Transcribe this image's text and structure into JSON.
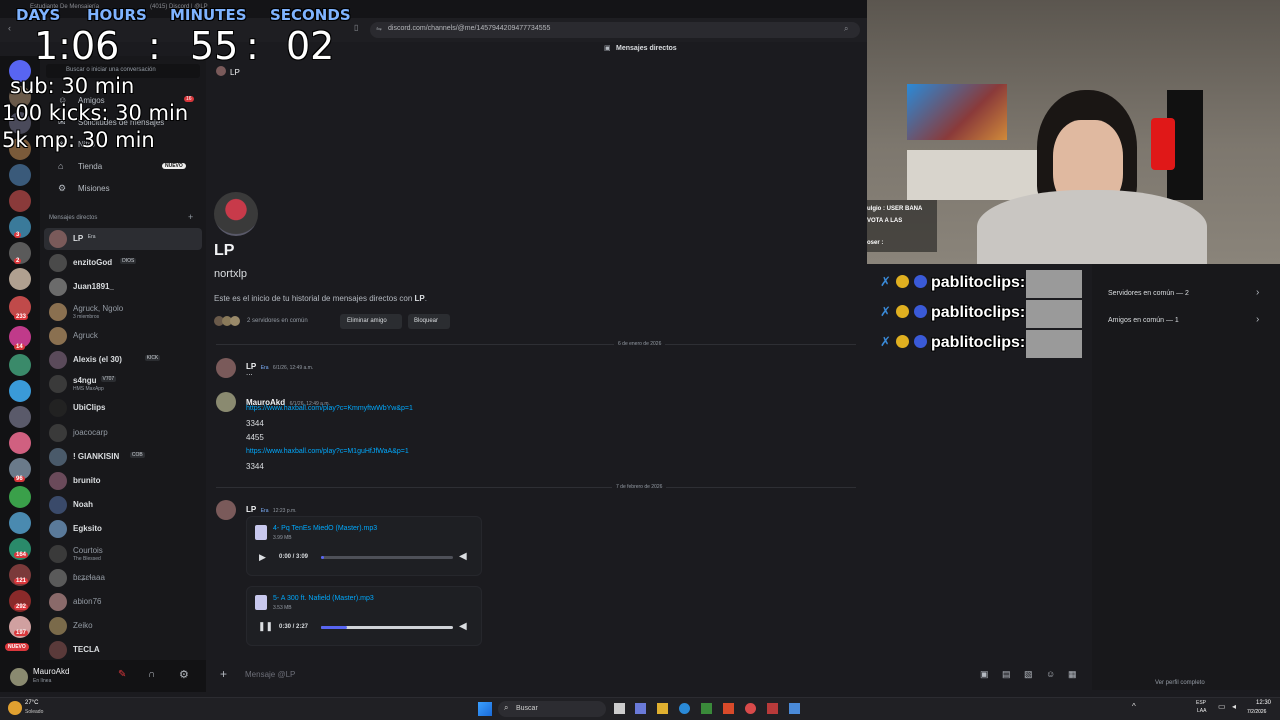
{
  "overlay": {
    "labels": {
      "days": "DAYS",
      "hours": "HOURS",
      "minutes": "MINUTES",
      "seconds": "SECONDS"
    },
    "time": {
      "hours": "1:06",
      "minutes": "55",
      "seconds": "02"
    },
    "rules": [
      "sub: 30 min",
      "100 kicks: 30 min",
      "5k mp: 30 min"
    ]
  },
  "browser": {
    "tabs": [
      "Estudiante De Mensajería",
      "(4015) Discord | @LP"
    ],
    "url": "discord.com/channels/@me/1457944209477734555"
  },
  "discord": {
    "top_title": "Mensajes directos",
    "search_placeholder": "Buscar o iniciar una conversación",
    "header_name": "LP",
    "nav": [
      {
        "label": "Amigos",
        "badge": "16"
      },
      {
        "label": "Solicitudes de mensajes",
        "badge": ""
      },
      {
        "label": "Nitro",
        "badge": ""
      },
      {
        "label": "Tienda",
        "badge": "NUEVO"
      },
      {
        "label": "Misiones",
        "badge": ""
      }
    ],
    "dm_section": "Mensajes directos",
    "dms": [
      {
        "name": "LP",
        "tag": "Era",
        "sub": "",
        "color": "#7a5a5a",
        "dim": false
      },
      {
        "name": "enzitoGod",
        "tag": "DIOS",
        "sub": "",
        "color": "#4a4a4a",
        "dim": false
      },
      {
        "name": "Juan1891_",
        "tag": "",
        "sub": "",
        "color": "#6b6b6b",
        "dim": false
      },
      {
        "name": "Agruck, Ngolo",
        "tag": "",
        "sub": "3 miembros",
        "color": "#8a7050",
        "dim": true
      },
      {
        "name": "Agruck",
        "tag": "",
        "sub": "",
        "color": "#8a7050",
        "dim": true
      },
      {
        "name": "Alexis (el 30)",
        "tag": "KICK",
        "sub": "",
        "color": "#5a4a5a",
        "dim": false
      },
      {
        "name": "s4ngu",
        "tag": "V707",
        "sub": "HMS MaxApp",
        "color": "#3a3a3a",
        "dim": false
      },
      {
        "name": "UbiClips",
        "tag": "",
        "sub": "",
        "color": "#222",
        "dim": false
      },
      {
        "name": "joacocarp",
        "tag": "",
        "sub": "",
        "color": "#3a3a3a",
        "dim": true
      },
      {
        "name": "! GIANKISIN",
        "tag": "COB",
        "sub": "",
        "color": "#4a5a6a",
        "dim": false
      },
      {
        "name": "brunito",
        "tag": "",
        "sub": "",
        "color": "#6a4a5a",
        "dim": false
      },
      {
        "name": "Noah",
        "tag": "",
        "sub": "",
        "color": "#3a4a6a",
        "dim": false
      },
      {
        "name": "Egksito",
        "tag": "",
        "sub": "",
        "color": "#5a7a9a",
        "dim": false
      },
      {
        "name": "Courtois",
        "tag": "",
        "sub": "The Blessed",
        "color": "#3a3a3a",
        "dim": true
      },
      {
        "name": "ɓɛʑɛɬaaa",
        "tag": "",
        "sub": "",
        "color": "#5a5a5a",
        "dim": true
      },
      {
        "name": "abion76",
        "tag": "",
        "sub": "",
        "color": "#8a6a6a",
        "dim": true
      },
      {
        "name": "Zeiko",
        "tag": "",
        "sub": "",
        "color": "#7a6a4a",
        "dim": true
      },
      {
        "name": "TECLA",
        "tag": "",
        "sub": "",
        "color": "#5a3a3a",
        "dim": false
      }
    ],
    "user": {
      "name": "MauroAkd",
      "status": "En línea"
    },
    "profile": {
      "display": "LP",
      "username": "nortxlp",
      "intro_prefix": "Este es el inicio de tu historial de mensajes directos con ",
      "intro_name": "LP",
      "intro_suffix": ".",
      "mutual": "2 servidores en común",
      "remove": "Eliminar amigo",
      "block": "Bloquear"
    },
    "dividers": [
      "6 de enero de 2026",
      "7 de febrero de 2026"
    ],
    "messages": [
      {
        "author": "LP",
        "tag": "Era",
        "time": "6/1/26, 12:49 a.m.",
        "lines": [
          "..."
        ]
      },
      {
        "author": "MauroAkd",
        "tag": "",
        "time": "6/1/26, 12:49 a.m.",
        "link1": "https://www.haxball.com/play?c=KmmyftwWbYw&p=1",
        "lines": [
          "3344",
          "4455"
        ],
        "link2": "https://www.haxball.com/play?c=M1guHfJfWaA&p=1",
        "tail": "3344"
      },
      {
        "author": "LP",
        "tag": "Era",
        "time": "12:23 p.m."
      }
    ],
    "attachments": [
      {
        "title": "4- Pq TenEs MiedO (Master).mp3",
        "size": "3.99 MB",
        "time": "0:00 / 3:09",
        "progress": 0.02,
        "playing": false
      },
      {
        "title": "5- A 300 ft. Nafield (Master).mp3",
        "size": "3.53 MB",
        "time": "0:30 / 2:27",
        "progress": 0.2,
        "playing": true
      }
    ],
    "input_placeholder": "Mensaje @LP",
    "side_panel": {
      "servers": "Servidores en común — 2",
      "friends": "Amigos en común — 1",
      "full_profile": "Ver perfil completo"
    }
  },
  "stream_chat": {
    "lines": [
      "pablitoclips:",
      "pablitoclips:",
      "pablitoclips:"
    ],
    "small": [
      "ulgio : USER BANA",
      "VOTA A LAS",
      "oser :"
    ]
  },
  "taskbar": {
    "weather": "27°C",
    "weather_sub": "Soleado",
    "search": "Buscar",
    "lang": "ESP",
    "lang_sub": "LAA",
    "clock": "12:30",
    "date": "7/2/2026"
  },
  "server_badges": [
    "3",
    "2",
    "233",
    "14",
    "96",
    "164",
    "121",
    "292",
    "197"
  ],
  "nuevo": "NUEVO"
}
